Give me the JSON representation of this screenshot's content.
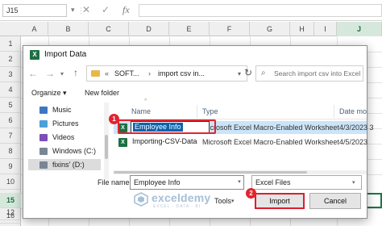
{
  "sheet": {
    "name_box": "J15",
    "formula_label": "fx",
    "columns": [
      "A",
      "B",
      "C",
      "D",
      "E",
      "F",
      "G",
      "H",
      "I",
      "J"
    ],
    "rows": [
      "1",
      "2",
      "3",
      "4",
      "5",
      "6",
      "7",
      "8",
      "9",
      "10",
      "11",
      "12",
      "13",
      "14",
      "15",
      "16"
    ],
    "active_row": "15"
  },
  "dialog": {
    "title": "Import Data",
    "address": {
      "prefix": "«",
      "crumb_1": "SOFT...",
      "separator": "›",
      "crumb_2": "import csv in..."
    },
    "search_placeholder": "Search import csv into Excel",
    "organize_label": "Organize ▾",
    "new_folder_label": "New folder",
    "nav_items": [
      {
        "label": "Music",
        "color": "#3a78c4"
      },
      {
        "label": "Pictures",
        "color": "#4aa0d8"
      },
      {
        "label": "Videos",
        "color": "#7b4fb5"
      },
      {
        "label": "Windows (C:)",
        "color": "#7a8696"
      },
      {
        "label": "fixins' (D:)",
        "color": "#7a8696"
      }
    ],
    "columns": {
      "name": "Name",
      "type": "Type",
      "date": "Date mo"
    },
    "files": [
      {
        "name": "Employee Info",
        "type": "Microsoft Excel Macro-Enabled Worksheet",
        "date": "4/3/2023 3"
      },
      {
        "name": "Importing-CSV-Data",
        "type": "Microsoft Excel Macro-Enabled Worksheet",
        "date": "4/5/2023"
      }
    ],
    "file_name_label": "File name:",
    "file_name_value": "Employee Info",
    "file_type": "Excel Files",
    "tools_label": "Tools",
    "import_label": "Import",
    "cancel_label": "Cancel",
    "callouts": [
      "1",
      "2"
    ]
  },
  "watermark": {
    "name": "exceldemy",
    "tagline": "EXCEL · DATA · BI"
  },
  "colors": {
    "excel_green": "#217346",
    "callout_red": "#e2242e",
    "selection_blue": "#cce4f7"
  }
}
